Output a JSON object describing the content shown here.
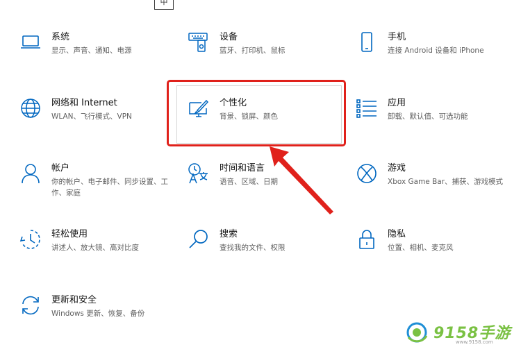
{
  "colors": {
    "accent": "#0067c0",
    "highlight": "#e0211b",
    "watermark": "#7ac143"
  },
  "top_fragment": "中",
  "tiles": [
    {
      "title": "系统",
      "desc": "显示、声音、通知、电源",
      "icon": "laptop-icon"
    },
    {
      "title": "设备",
      "desc": "蓝牙、打印机、鼠标",
      "icon": "devices-icon"
    },
    {
      "title": "手机",
      "desc": "连接 Android 设备和 iPhone",
      "icon": "phone-icon"
    },
    {
      "title": "网络和 Internet",
      "desc": "WLAN、飞行模式、VPN",
      "icon": "globe-icon"
    },
    {
      "title": "个性化",
      "desc": "背景、锁屏、颜色",
      "icon": "personalization-icon"
    },
    {
      "title": "应用",
      "desc": "卸载、默认值、可选功能",
      "icon": "apps-list-icon"
    },
    {
      "title": "帐户",
      "desc": "你的帐户、电子邮件、同步设置、工作、家庭",
      "icon": "person-icon"
    },
    {
      "title": "时间和语言",
      "desc": "语音、区域、日期",
      "icon": "time-language-icon"
    },
    {
      "title": "游戏",
      "desc": "Xbox Game Bar、捕获、游戏模式",
      "icon": "xbox-icon"
    },
    {
      "title": "轻松使用",
      "desc": "讲述人、放大镜、高对比度",
      "icon": "ease-of-access-icon"
    },
    {
      "title": "搜索",
      "desc": "查找我的文件、权限",
      "icon": "search-icon"
    },
    {
      "title": "隐私",
      "desc": "位置、相机、麦克风",
      "icon": "lock-icon"
    },
    {
      "title": "更新和安全",
      "desc": "Windows 更新、恢复、备份",
      "icon": "sync-icon"
    }
  ],
  "watermark": {
    "text": "9158手游",
    "url": "www.9158.com"
  }
}
